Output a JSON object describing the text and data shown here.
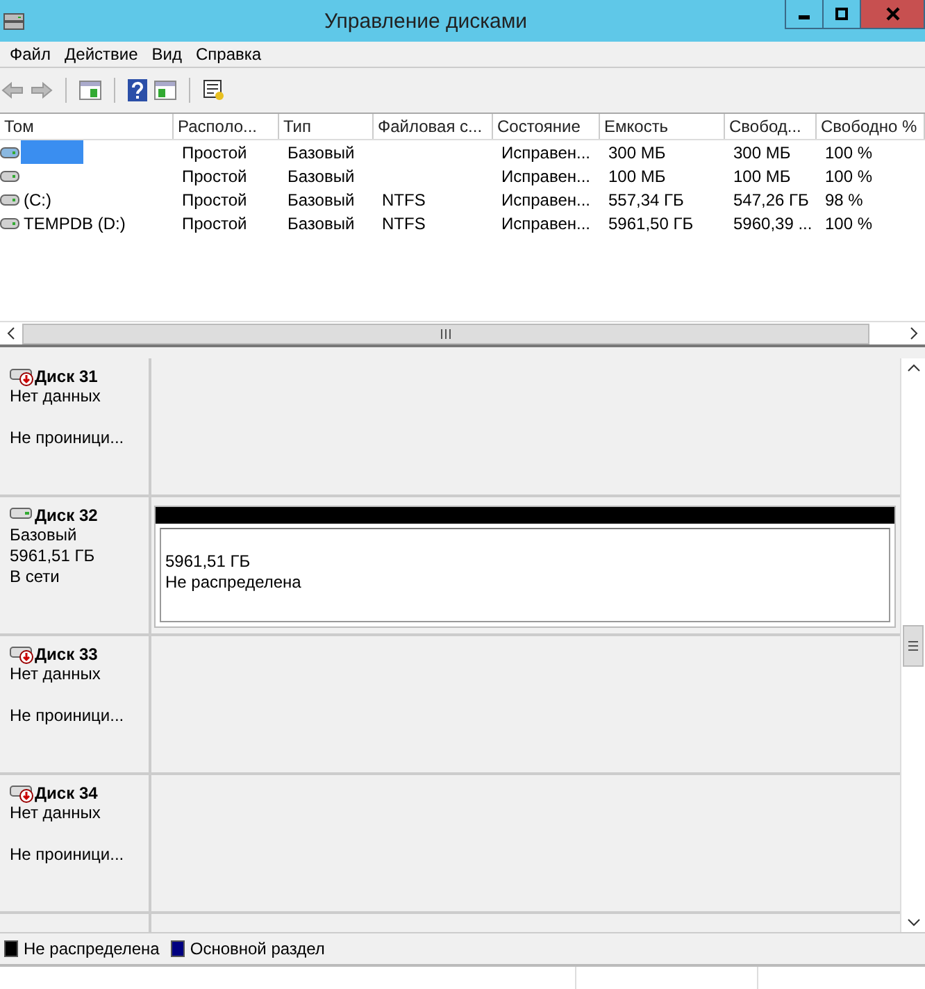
{
  "window": {
    "title": "Управление дисками"
  },
  "menu": [
    "Файл",
    "Действие",
    "Вид",
    "Справка"
  ],
  "table": {
    "columns": [
      "Том",
      "Располо...",
      "Тип",
      "Файловая с...",
      "Состояние",
      "Емкость",
      "Свобод...",
      "Свободно %"
    ],
    "rows": [
      {
        "redacted": true,
        "cells": [
          "",
          "Простой",
          "Базовый",
          "",
          "Исправен...",
          "300 МБ",
          "300 МБ",
          "100 %"
        ]
      },
      {
        "redacted": false,
        "cells": [
          "",
          "Простой",
          "Базовый",
          "",
          "Исправен...",
          "100 МБ",
          "100 МБ",
          "100 %"
        ]
      },
      {
        "redacted": false,
        "cells": [
          "(C:)",
          "Простой",
          "Базовый",
          "NTFS",
          "Исправен...",
          "557,34 ГБ",
          "547,26 ГБ",
          "98 %"
        ]
      },
      {
        "redacted": false,
        "cells": [
          "TEMPDB (D:)",
          "Простой",
          "Базовый",
          "NTFS",
          "Исправен...",
          "5961,50 ГБ",
          "5960,39 ...",
          "100 %"
        ]
      }
    ]
  },
  "disks": [
    {
      "kind": "no-data",
      "name": "Диск 31",
      "lines": [
        "Нет данных",
        "Не проиници..."
      ]
    },
    {
      "kind": "basic",
      "name": "Диск 32",
      "lines": [
        "Базовый",
        "5961,51 ГБ",
        "В сети"
      ],
      "partition": {
        "size": "5961,51 ГБ",
        "label": "Не распределена",
        "color": "#000000"
      }
    },
    {
      "kind": "no-data",
      "name": "Диск 33",
      "lines": [
        "Нет данных",
        "Не проиници..."
      ]
    },
    {
      "kind": "no-data",
      "name": "Диск 34",
      "lines": [
        "Нет данных",
        "Не проиници..."
      ]
    },
    {
      "kind": "partial"
    }
  ],
  "legend": [
    {
      "label": "Не распределена",
      "color": "#000000"
    },
    {
      "label": "Основной раздел",
      "color": "#000080"
    }
  ]
}
